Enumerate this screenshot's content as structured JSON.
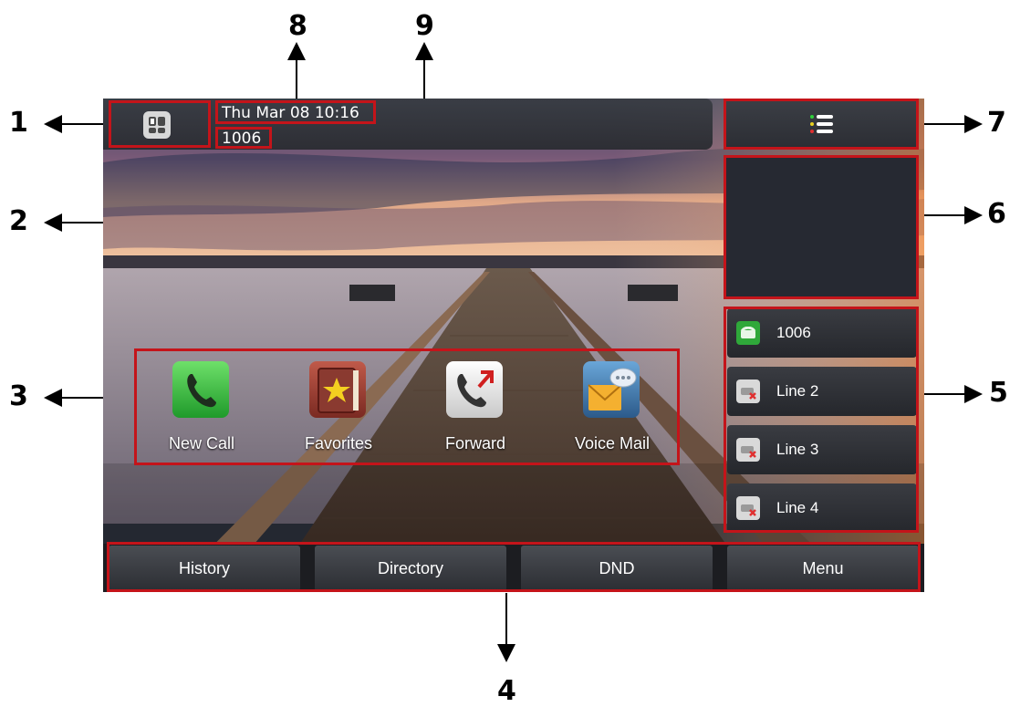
{
  "callouts": {
    "c1": "1",
    "c2": "2",
    "c3": "3",
    "c4": "4",
    "c5": "5",
    "c6": "6",
    "c7": "7",
    "c8": "8",
    "c9": "9"
  },
  "status_bar": {
    "datetime": "Thu Mar 08 10:16",
    "account": "1006",
    "apps_icon": "apps-grid-icon",
    "menu_icon": "list-menu-icon"
  },
  "dsskeys": [
    {
      "label": "New Call",
      "icon": "phone-icon"
    },
    {
      "label": "Favorites",
      "icon": "favorites-book-icon"
    },
    {
      "label": "Forward",
      "icon": "forward-call-icon"
    },
    {
      "label": "Voice Mail",
      "icon": "voicemail-icon"
    }
  ],
  "line_keys": [
    {
      "label": "1006",
      "status": "registered"
    },
    {
      "label": "Line 2",
      "status": "unregistered"
    },
    {
      "label": "Line 3",
      "status": "unregistered"
    },
    {
      "label": "Line 4",
      "status": "unregistered"
    }
  ],
  "softkeys": [
    {
      "label": "History"
    },
    {
      "label": "Directory"
    },
    {
      "label": "DND"
    },
    {
      "label": "Menu"
    }
  ],
  "colors": {
    "highlight": "#c4141a",
    "registered": "#2fa83a",
    "unregistered": "#e03030"
  }
}
